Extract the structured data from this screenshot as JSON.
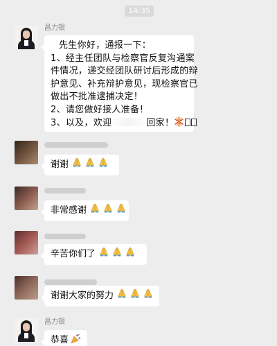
{
  "chat": {
    "timestamp": "14:35",
    "lawyer_name": "昌力银",
    "main_message": {
      "line1": "先生你好，通报一下：",
      "line2": "1、经主任团队与检察官反复沟通案",
      "line3": "件情况，递交经团队研讨后形成的辩",
      "line4": "护意见、补充辩护意见，现检察官已",
      "line5": "做出不批准逮捕决定！",
      "line6": "2、请您做好接人准备！",
      "line7_prefix": "3、以及，欢迎",
      "line7_suffix": "回家！",
      "line7_trailing_emoji": "fireworks-icon"
    },
    "replies": [
      {
        "text": "谢谢",
        "emoji": "folded-hands-icon",
        "emoji_count": 3
      },
      {
        "text": "非常感谢",
        "emoji": "folded-hands-icon",
        "emoji_count": 3
      },
      {
        "text": "辛苦你们了",
        "emoji": "folded-hands-icon",
        "emoji_count": 3
      },
      {
        "text": "谢谢大家的努力",
        "emoji": "folded-hands-icon",
        "emoji_count": 3
      }
    ],
    "final_message": {
      "text": "恭喜",
      "emoji": "party-popper-icon"
    }
  },
  "colors": {
    "background": "#ededed",
    "bubble": "#ffffff",
    "timestamp_bg": "#dadada",
    "sender_name": "#888888"
  }
}
